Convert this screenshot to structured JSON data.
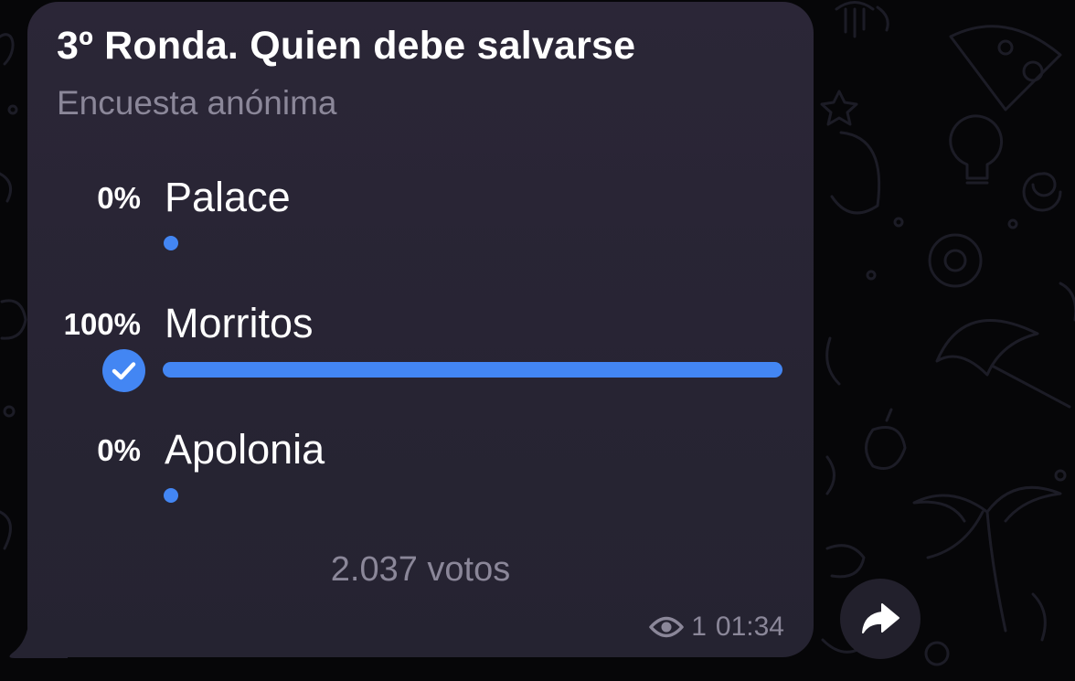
{
  "poll": {
    "question": "3º Ronda. Quien debe salvarse",
    "type": "Encuesta anónima",
    "options": [
      {
        "percent": "0%",
        "label": "Palace",
        "fraction": 0.0,
        "chosen": false
      },
      {
        "percent": "100%",
        "label": "Morritos",
        "fraction": 1.0,
        "chosen": true
      },
      {
        "percent": "0%",
        "label": "Apolonia",
        "fraction": 0.0,
        "chosen": false
      }
    ],
    "votes": "2.037 votos",
    "views": "1",
    "time": "01:34"
  },
  "icons": {
    "check": "check-icon",
    "views": "eye-icon",
    "share": "share-arrow-icon"
  },
  "colors": {
    "accent": "#4386f3",
    "bubble": "#2a2636",
    "text": "#ffffff",
    "secondary": "#8b8799",
    "background": "#060608"
  }
}
